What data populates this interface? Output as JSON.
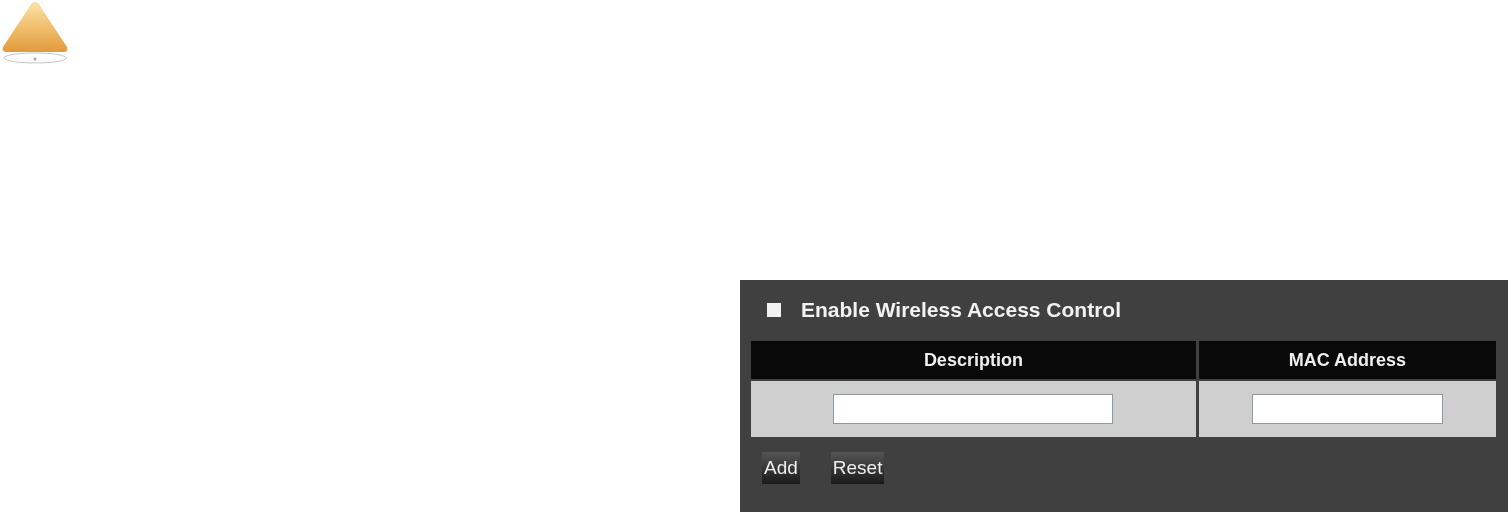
{
  "access_control": {
    "label": "Enable Wireless Access Control",
    "checked": false
  },
  "table": {
    "columns": [
      "Description",
      "MAC Address"
    ]
  },
  "buttons": [
    "Add",
    "Reset"
  ]
}
